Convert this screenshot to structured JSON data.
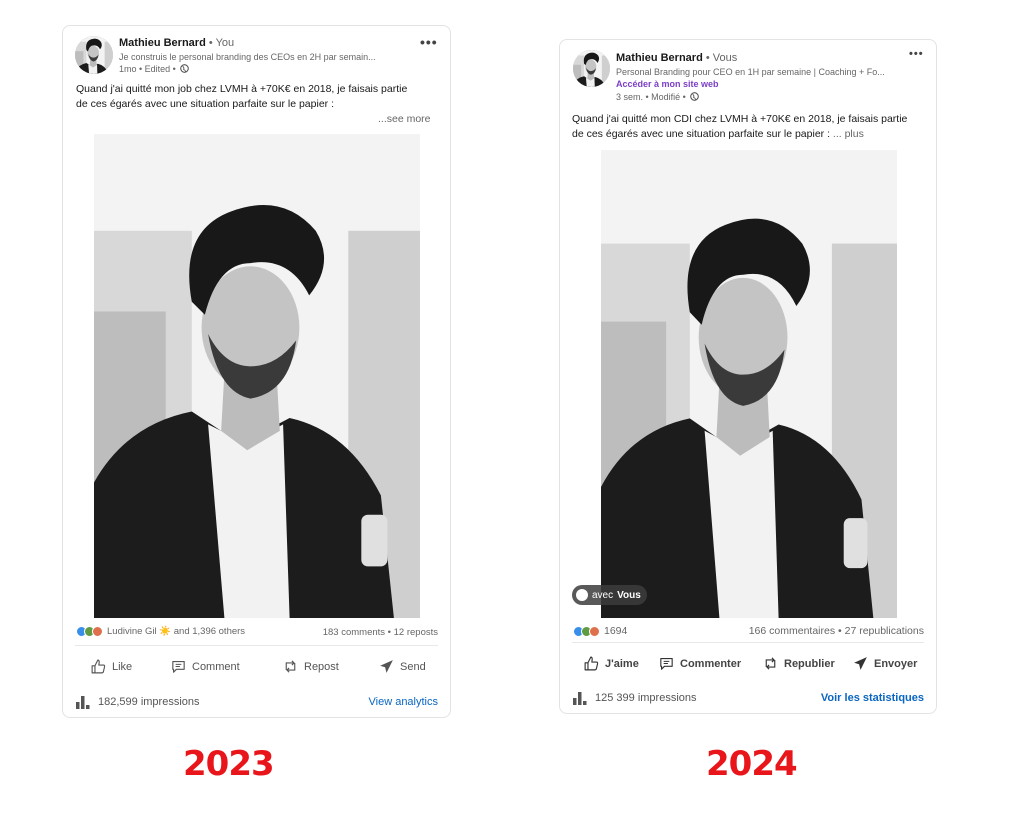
{
  "post_2023": {
    "author_name": "Mathieu Bernard",
    "author_relation": "• You",
    "headline": "Je construis le personal branding des CEOs en 2H par semain...",
    "meta": "1mo • Edited •",
    "text_line1": "Quand j'ai quitté mon job chez LVMH à +70K€ en 2018, je faisais partie",
    "text_line2": "de ces égarés avec une situation parfaite sur le papier :",
    "see_more": "...see more",
    "reactions_text": "Ludivine Gil ☀️ and 1,396 others",
    "counts": "183 comments • 12 reposts",
    "actions": {
      "like": "Like",
      "comment": "Comment",
      "repost": "Repost",
      "send": "Send"
    },
    "impressions": "182,599 impressions",
    "analytics": "View analytics",
    "year": "2023"
  },
  "post_2024": {
    "author_name": "Mathieu Bernard",
    "author_relation": "• Vous",
    "headline": "Personal Branding pour CEO en 1H par semaine | Coaching + Fo...",
    "site_link": "Accéder à mon site web",
    "meta": "3 sem. • Modifié •",
    "text_line1": "Quand j'ai quitté mon CDI chez LVMH à +70K€ en 2018, je faisais partie",
    "text_line2": "de ces égarés avec une situation parfaite sur le papier :",
    "see_more": "... plus",
    "tag_prefix": "avec",
    "tag_name": "Vous",
    "reactions_text": "1694",
    "counts": "166 commentaires • 27 republications",
    "actions": {
      "like": "J'aime",
      "comment": "Commenter",
      "repost": "Republier",
      "send": "Envoyer"
    },
    "impressions": "125 399 impressions",
    "analytics": "Voir les statistiques",
    "year": "2024"
  },
  "icons": [
    "more-options-icon",
    "globe-icon",
    "like-icon",
    "comment-icon",
    "repost-icon",
    "send-icon",
    "analytics-bar-icon",
    "person-icon"
  ],
  "colors": {
    "year_label": "#e8151b",
    "link_blue": "#0a66c2",
    "site_link_purple": "#7b3fc6"
  }
}
